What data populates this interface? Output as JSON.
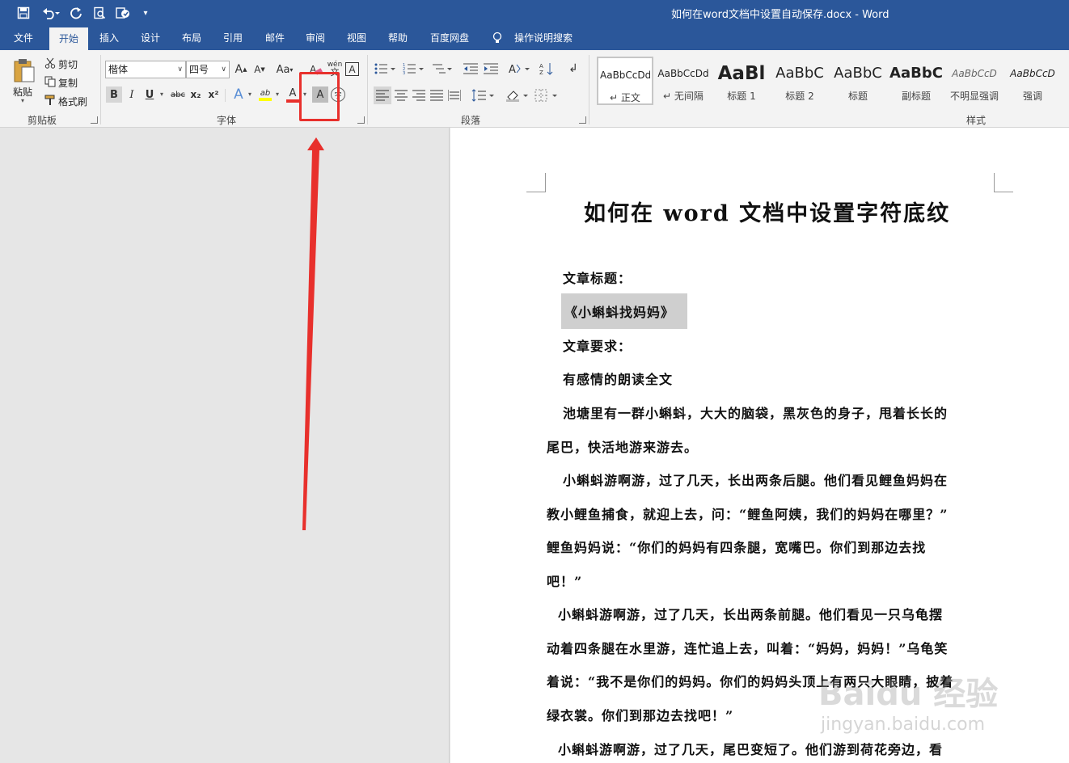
{
  "window": {
    "title": "如何在word文档中设置自动保存.docx  -  Word"
  },
  "quick_access": {
    "icons": [
      "save-icon",
      "undo-icon",
      "redo-icon",
      "print-preview-icon",
      "touch-mode-icon",
      "customize-toolbar-icon"
    ]
  },
  "tabs": [
    {
      "label": "文件",
      "active": false
    },
    {
      "label": "开始",
      "active": true
    },
    {
      "label": "插入",
      "active": false
    },
    {
      "label": "设计",
      "active": false
    },
    {
      "label": "布局",
      "active": false
    },
    {
      "label": "引用",
      "active": false
    },
    {
      "label": "邮件",
      "active": false
    },
    {
      "label": "审阅",
      "active": false
    },
    {
      "label": "视图",
      "active": false
    },
    {
      "label": "帮助",
      "active": false
    },
    {
      "label": "百度网盘",
      "active": false
    }
  ],
  "tell_me": "操作说明搜索",
  "clipboard": {
    "paste": "粘贴",
    "cut": "剪切",
    "copy": "复制",
    "format_painter": "格式刷",
    "group_label": "剪贴板"
  },
  "font": {
    "font_name": "楷体",
    "font_size": "四号",
    "grow": "A",
    "shrink": "A",
    "case": "Aa",
    "phonetic": "wén",
    "border": "A",
    "bold": "B",
    "italic": "I",
    "underline": "U",
    "strike": "abc",
    "subscript": "x₂",
    "superscript": "x²",
    "effects": "A",
    "highlight": "ab",
    "font_color": "A",
    "shading": "A",
    "enclose": "字",
    "group_label": "字体"
  },
  "paragraph": {
    "group_label": "段落"
  },
  "styles": {
    "items": [
      {
        "preview": "AaBbCcDd",
        "name": "正文",
        "selected": true
      },
      {
        "preview": "AaBbCcDd",
        "name": "无间隔",
        "selected": false
      },
      {
        "preview": "AaBl",
        "name": "标题 1",
        "selected": false
      },
      {
        "preview": "AaBbC",
        "name": "标题 2",
        "selected": false
      },
      {
        "preview": "AaBbC",
        "name": "标题",
        "selected": false
      },
      {
        "preview": "AaBbC",
        "name": "副标题",
        "selected": false
      },
      {
        "preview": "AaBbCcD",
        "name": "不明显强调",
        "selected": false
      },
      {
        "preview": "AaBbCcD",
        "name": "强调",
        "selected": false
      }
    ],
    "group_label": "样式"
  },
  "document": {
    "heading": "如何在 word 文档中设置字符底纹",
    "lines": [
      "文章标题：",
      "《小蝌蚪找妈妈》",
      "文章要求：",
      "有感情的朗读全文",
      "池塘里有一群小蝌蚪，大大的脑袋，黑灰色的身子，甩着长长的",
      "尾巴，快活地游来游去。",
      "小蝌蚪游啊游，过了几天，长出两条后腿。他们看见鲤鱼妈妈在",
      "教小鲤鱼捕食，就迎上去，问：“鲤鱼阿姨，我们的妈妈在哪里？”",
      "鲤鱼妈妈说：“你们的妈妈有四条腿，宽嘴巴。你们到那边去找",
      "吧！”",
      "小蝌蚪游啊游，过了几天，长出两条前腿。他们看见一只乌龟摆",
      "动着四条腿在水里游，连忙追上去，叫着：“妈妈，妈妈！”乌龟笑",
      "着说：“我不是你们的妈妈。你们的妈妈头顶上有两只大眼睛，披着",
      "绿衣裳。你们到那边去找吧！”",
      "小蝌蚪游啊游，过了几天，尾巴变短了。他们游到荷花旁边，看"
    ]
  },
  "watermark": {
    "brand": "Baidu 经验",
    "url": "jingyan.baidu.com"
  },
  "colors": {
    "accent": "#2b579a",
    "annotation": "#e8302c",
    "shading": "#cfcfcf"
  }
}
